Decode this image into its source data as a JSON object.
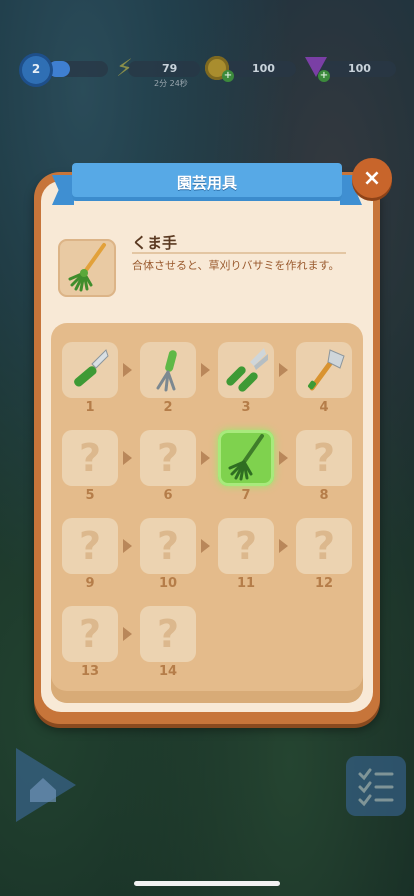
{
  "hud": {
    "level": "2",
    "energy": "79",
    "energy_timer": "2分 24秒",
    "coins": "100",
    "gems": "100"
  },
  "dialog": {
    "title": "園芸用具",
    "close_label": "×",
    "selected_item": {
      "name": "くま手",
      "description": "合体させると、草刈りバサミを作れます。",
      "icon": "rake-icon"
    },
    "chain": [
      {
        "number": "1",
        "state": "unlocked",
        "icon": "pruning-knife-icon"
      },
      {
        "number": "2",
        "state": "unlocked",
        "icon": "hand-fork-icon"
      },
      {
        "number": "3",
        "state": "unlocked",
        "icon": "pruning-shears-icon"
      },
      {
        "number": "4",
        "state": "unlocked",
        "icon": "hatchet-icon"
      },
      {
        "number": "5",
        "state": "unknown",
        "icon": "question-mark-icon"
      },
      {
        "number": "6",
        "state": "unknown",
        "icon": "question-mark-icon"
      },
      {
        "number": "7",
        "state": "selected",
        "icon": "rake-icon"
      },
      {
        "number": "8",
        "state": "unknown",
        "icon": "question-mark-icon"
      },
      {
        "number": "9",
        "state": "unknown",
        "icon": "question-mark-icon"
      },
      {
        "number": "10",
        "state": "unknown",
        "icon": "question-mark-icon"
      },
      {
        "number": "11",
        "state": "unknown",
        "icon": "question-mark-icon"
      },
      {
        "number": "12",
        "state": "unknown",
        "icon": "question-mark-icon"
      },
      {
        "number": "13",
        "state": "unknown",
        "icon": "question-mark-icon"
      },
      {
        "number": "14",
        "state": "unknown",
        "icon": "question-mark-icon"
      }
    ],
    "unknown_glyph": "?"
  },
  "colors": {
    "ribbon": "#57a9e6",
    "frame": "#c7753a",
    "selected_cell": "#7fd24e"
  }
}
